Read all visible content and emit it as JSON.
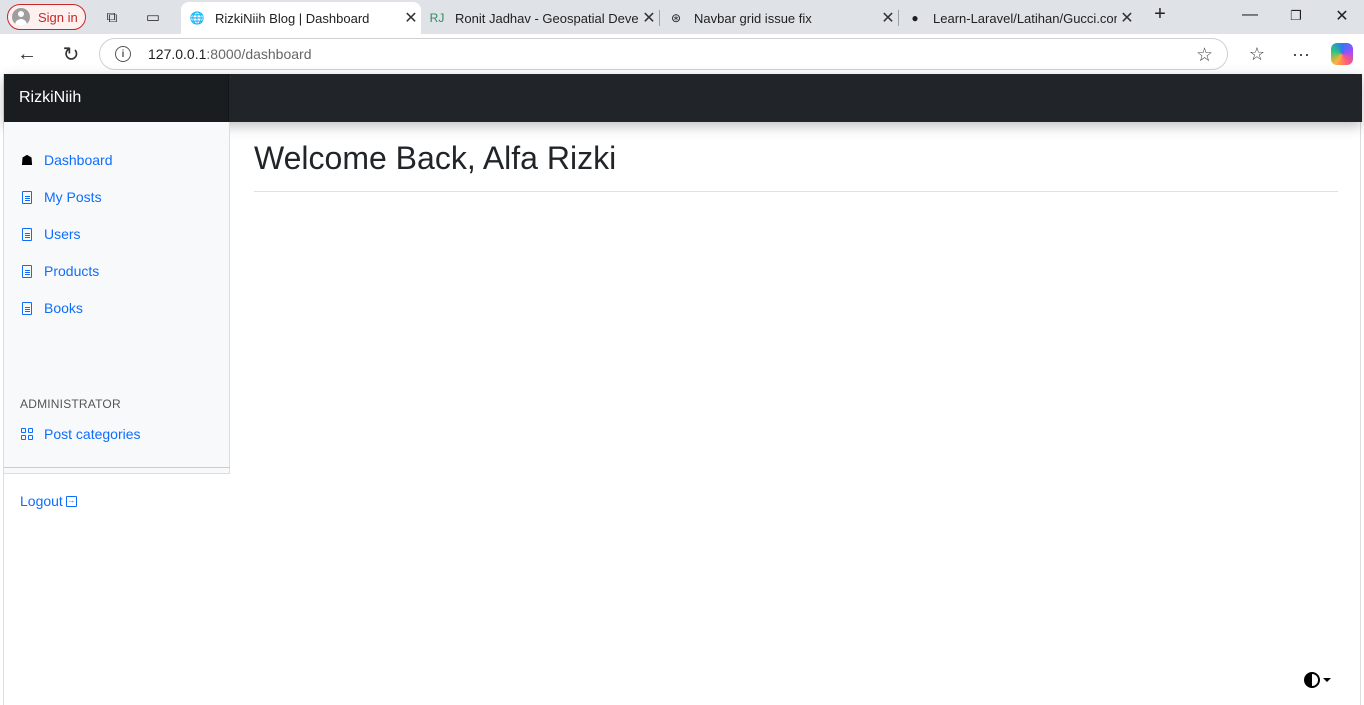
{
  "browser": {
    "signin_label": "Sign in",
    "tabs": [
      {
        "title": "RizkiNiih Blog | Dashboard",
        "active": true
      },
      {
        "title": "Ronit Jadhav - Geospatial Develo"
      },
      {
        "title": "Navbar grid issue fix"
      },
      {
        "title": "Learn-Laravel/Latihan/Gucci.com"
      }
    ],
    "url_host": "127.0.0.1",
    "url_path": ":8000/dashboard"
  },
  "app": {
    "brand": "RizkiNiih",
    "nav": [
      {
        "label": "Dashboard",
        "icon": "home-icon"
      },
      {
        "label": "My Posts",
        "icon": "file-icon"
      },
      {
        "label": "Users",
        "icon": "file-icon"
      },
      {
        "label": "Products",
        "icon": "file-icon"
      },
      {
        "label": "Books",
        "icon": "file-icon"
      }
    ],
    "admin_heading": "ADMINISTRATOR",
    "admin_nav": [
      {
        "label": "Post categories",
        "icon": "grid-icon"
      }
    ],
    "logout_label": "Logout",
    "page_title": "Welcome Back, Alfa Rizki"
  }
}
